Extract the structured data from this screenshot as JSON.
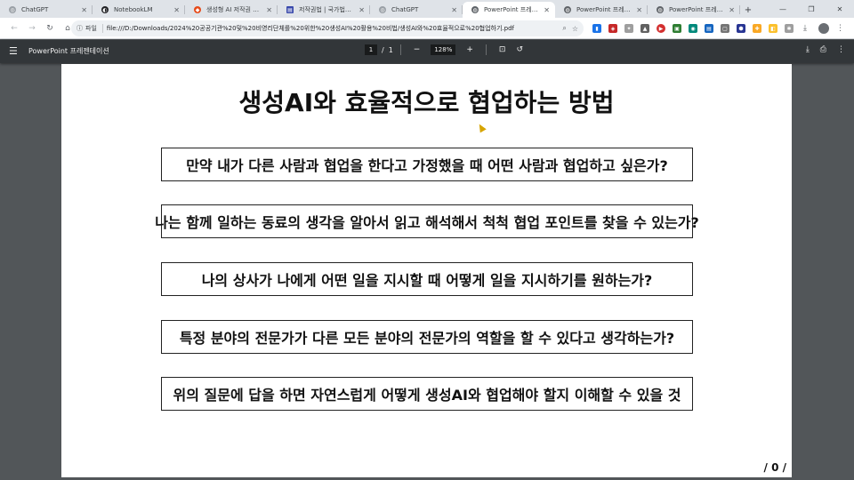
{
  "browser": {
    "tabs": [
      {
        "title": "ChatGPT",
        "icon": "chatgpt-icon",
        "color": "#9aa0a6"
      },
      {
        "title": "NotebookLM",
        "icon": "notebooklm-icon",
        "color": "#202124"
      },
      {
        "title": "생성형 AI 저작권 안내서(...",
        "icon": "pdf-icon",
        "color": "#e64a19"
      },
      {
        "title": "저작권법 | 국가법령정보...",
        "icon": "law-icon",
        "color": "#3949ab"
      },
      {
        "title": "ChatGPT",
        "icon": "chatgpt-icon",
        "color": "#9aa0a6"
      },
      {
        "title": "PowerPoint 프레젠테이션",
        "icon": "globe-icon",
        "color": "#5f6368",
        "active": true
      },
      {
        "title": "PowerPoint 프레젠테이션",
        "icon": "globe-icon",
        "color": "#5f6368"
      },
      {
        "title": "PowerPoint 프레젠테이션",
        "icon": "globe-icon",
        "color": "#5f6368"
      }
    ],
    "file_chip": "파일",
    "url": "file:///D:/Downloads/2024%20공공기관%20및%20비영리단체를%20위한%20생성AI%20활용%20비법/생성AI와%20효율적으로%20협업하기.pdf"
  },
  "pdf_viewer": {
    "title": "PowerPoint 프레젠테이션",
    "current_page": "1",
    "page_sep": "/",
    "total_pages": "1",
    "zoom": "128%"
  },
  "slide": {
    "title": "생성AI와 효율적으로 협업하는 방법",
    "questions": [
      "만약 내가 다른 사람과 협업을 한다고 가정했을 때 어떤 사람과 협업하고 싶은가?",
      "나는 함께 일하는 동료의 생각을 알아서 읽고 해석해서 척척 협업 포인트를 찾을 수 있는가?",
      "나의 상사가 나에게 어떤 일을 지시할 때 어떻게 일을 지시하기를 원하는가?",
      "특정 분야의 전문가가 다른 모든 분야의 전문가의 역할을 할 수 있다고 생각하는가?",
      "위의 질문에 답을 하면 자연스럽게 어떻게 생성AI와 협업해야 할지 이해할 수 있을 것"
    ],
    "page_number": "/ 0 /"
  }
}
